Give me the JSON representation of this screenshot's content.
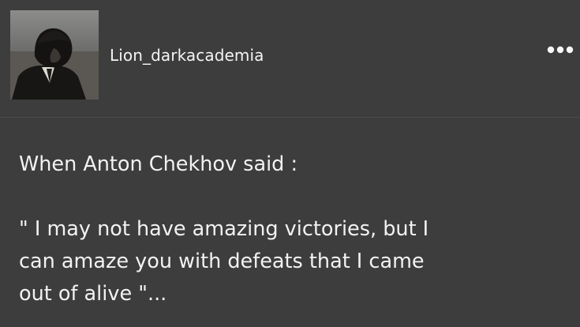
{
  "header": {
    "username": "Lion_darkacademia",
    "more_icon": "ellipsis-horizontal-icon"
  },
  "body": {
    "intro": "When Anton Chekhov said :",
    "quote": "\" I may not have amazing victories, but I\ncan amaze you with defeats that I came\nout of alive \"..."
  },
  "colors": {
    "background": "#3d3d3d",
    "text": "#f2f2f2",
    "divider": "#4b4b4b"
  }
}
